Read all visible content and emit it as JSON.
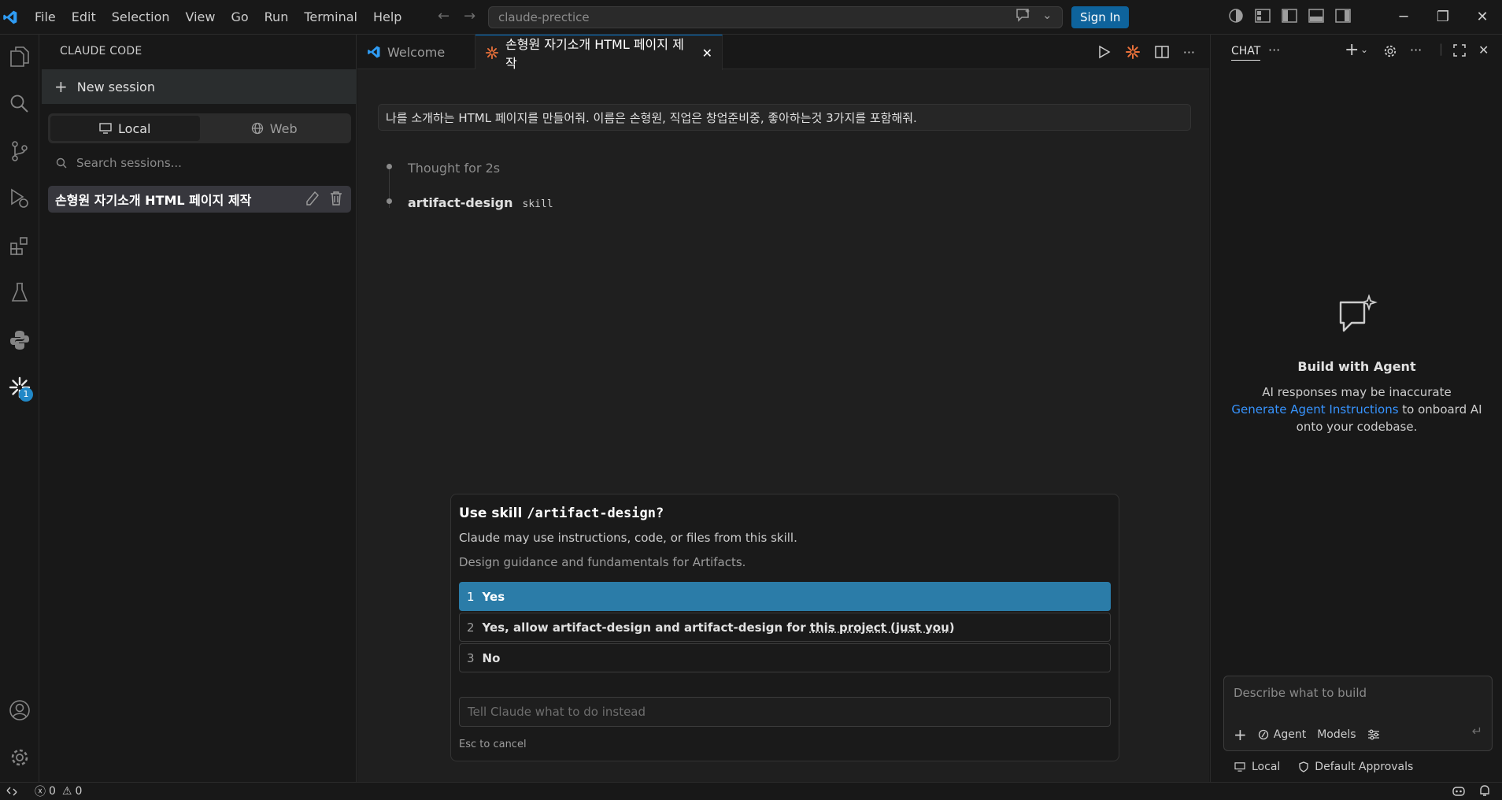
{
  "menu": [
    "File",
    "Edit",
    "Selection",
    "View",
    "Go",
    "Run",
    "Terminal",
    "Help"
  ],
  "command_center": {
    "placeholder": "claude-prectice"
  },
  "signin_label": "Sign In",
  "sidebar": {
    "title": "CLAUDE CODE",
    "new_session": "New session",
    "seg_local": "Local",
    "seg_web": "Web",
    "search_placeholder": "Search sessions...",
    "session_title": "손형원 자기소개 HTML 페이지 제작"
  },
  "activity_badge": "1",
  "tabs": {
    "welcome": "Welcome",
    "active": "손형원 자기소개 HTML 페이지 제작"
  },
  "conversation": {
    "user_message": "나를 소개하는 HTML 페이지를 만들어줘. 이름은 손형원, 직업은 창업준비중, 좋아하는것 3가지를 포함해줘.",
    "thought": "Thought for 2s",
    "skill_name": "artifact-design",
    "skill_tag": "skill"
  },
  "dialog": {
    "title_prefix": "Use skill ",
    "title_skill": "/artifact-design?",
    "subtitle": "Claude may use instructions, code, or files from this skill.",
    "description": "Design guidance and fundamentals for Artifacts.",
    "options": [
      {
        "num": "1",
        "label": "Yes"
      },
      {
        "num": "2",
        "label_a": "Yes, allow artifact-design and artifact-design for ",
        "label_b": "this project",
        "label_c": " (just you)"
      },
      {
        "num": "3",
        "label": "No"
      }
    ],
    "input_placeholder": "Tell Claude what to do instead",
    "esc_hint": "Esc to cancel"
  },
  "chat": {
    "tab": "CHAT",
    "heading": "Build with Agent",
    "line1": "AI responses may be inaccurate",
    "link": "Generate Agent Instructions",
    "line2": " to onboard AI",
    "line3": "onto your codebase.",
    "input_placeholder": "Describe what to build",
    "agent": "Agent",
    "models": "Models",
    "foot_local": "Local",
    "foot_approvals": "Default Approvals"
  },
  "status": {
    "errors": "0",
    "warnings": "0"
  },
  "colors": {
    "accent": "#0078d4",
    "selected_option": "#2b7ca8",
    "claude_orange": "#e8703a",
    "link": "#3794ff"
  }
}
